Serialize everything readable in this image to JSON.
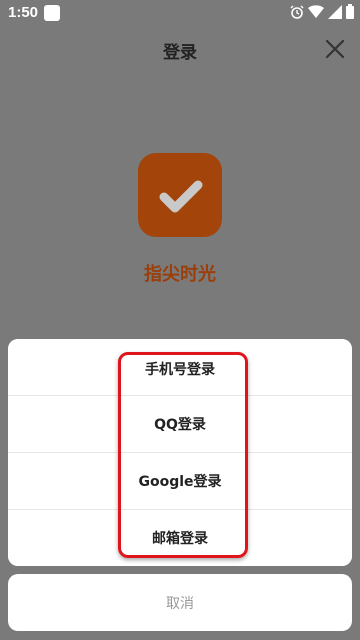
{
  "status_bar": {
    "time": "1:50",
    "icons": [
      "app-notification-icon",
      "alarm-icon",
      "wifi-icon",
      "signal-icon",
      "battery-icon"
    ]
  },
  "header": {
    "title": "登录",
    "close_icon": "close-icon"
  },
  "app": {
    "name": "指尖时光",
    "logo_icon": "checkmark-icon"
  },
  "login_options": [
    {
      "label": "手机号登录"
    },
    {
      "label": "QQ登录"
    },
    {
      "label": "Google登录"
    },
    {
      "label": "邮箱登录"
    }
  ],
  "cancel_label": "取消",
  "colors": {
    "overlay_bg": "#7a7a7a",
    "logo_bg": "#a3440b",
    "app_name": "#9a3f0a",
    "highlight": "#e0141c"
  }
}
